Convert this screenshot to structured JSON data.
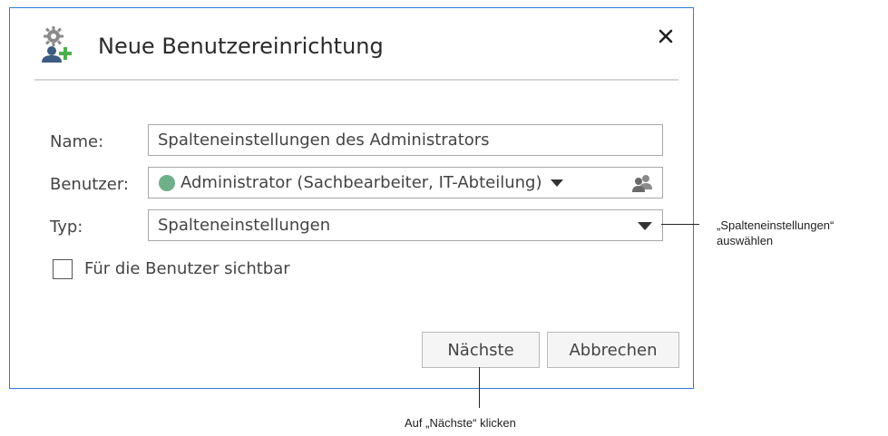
{
  "dialog": {
    "title": "Neue Benutzereinrichtung",
    "close_symbol": "✕",
    "icons": {
      "title": "gear-user-add-icon",
      "close": "close-icon",
      "users": "users-icon"
    }
  },
  "form": {
    "name_label": "Name:",
    "name_value": "Spalteneinstellungen des Administrators",
    "user_label": "Benutzer:",
    "user_value": "Administrator (Sachbearbeiter, IT-Abteilung)",
    "user_status_color": "#6fb08b",
    "type_label": "Typ:",
    "type_value": "Spalteneinstellungen",
    "visible_checkbox_label": "Für die Benutzer sichtbar",
    "visible_checked": false
  },
  "buttons": {
    "next_label": "Nächste",
    "cancel_label": "Abbrechen"
  },
  "annotations": {
    "type_hint_line1": "„Spalteneinstellungen“",
    "type_hint_line2": "auswählen",
    "next_hint": "Auf „Nächste“ klicken"
  },
  "colors": {
    "dialog_border": "#2e7bd6",
    "accent_green": "#4caf50",
    "icon_gray": "#7a7a7a"
  }
}
